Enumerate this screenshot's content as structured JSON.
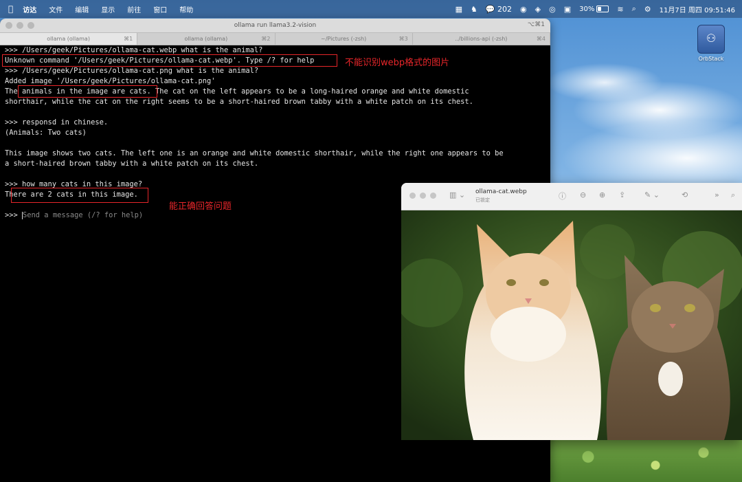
{
  "menubar": {
    "apple": "",
    "items": [
      "访达",
      "文件",
      "编辑",
      "显示",
      "前往",
      "窗口",
      "帮助"
    ],
    "wechat_count": "202",
    "battery": "30%",
    "battery_level": 0.3,
    "datetime": "11月7日 周四  09:51:46"
  },
  "desktop": {
    "icon_label": "OrbStack"
  },
  "terminal": {
    "title": "ollama run llama3.2-vision",
    "shortcut": "⌥⌘1",
    "tabs": [
      {
        "label": "ollama (ollama)",
        "key": "⌘1"
      },
      {
        "label": "ollama (ollama)",
        "key": "⌘2"
      },
      {
        "label": "~/Pictures (-zsh)",
        "key": "⌘3"
      },
      {
        "label": "../billions-api (-zsh)",
        "key": "⌘4"
      }
    ],
    "lines": [
      ">>> /Users/geek/Pictures/ollama-cat.webp what is the animal?",
      "Unknown command '/Users/geek/Pictures/ollama-cat.webp'. Type /? for help",
      ">>> /Users/geek/Pictures/ollama-cat.png what is the animal?",
      "Added image '/Users/geek/Pictures/ollama-cat.png'",
      "The animals in the image are cats. The cat on the left appears to be a long-haired orange and white domestic",
      "shorthair, while the cat on the right seems to be a short-haired brown tabby with a white patch on its chest.",
      "",
      ">>> responsd in chinese.",
      "(Animals: Two cats)",
      "",
      "This image shows two cats. The left one is an orange and white domestic shorthair, while the right one appears to be",
      "a short-haired brown tabby with a white patch on its chest.",
      "",
      ">>> how many cats in this image?",
      "There are 2 cats in this image.",
      "",
      ""
    ],
    "input_prompt": ">>> ",
    "input_placeholder": "Send a message (/? for help)"
  },
  "annotations": {
    "webp_note": "不能识别webp格式的图片",
    "answer_note": "能正确回答问题"
  },
  "preview": {
    "filename": "ollama-cat.webp",
    "status": "已锁定"
  }
}
